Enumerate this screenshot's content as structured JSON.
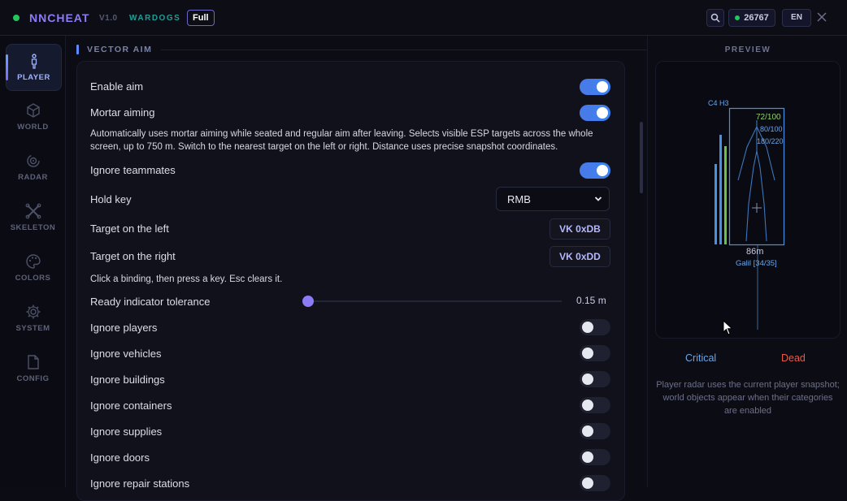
{
  "header": {
    "app_title": "NNCHEAT",
    "version": "V1.0",
    "brand": "WARDOGS",
    "badge": "Full",
    "credits": "26767",
    "language": "EN"
  },
  "sidebar": {
    "items": [
      {
        "label": "PLAYER",
        "icon": "person-icon",
        "active": true
      },
      {
        "label": "WORLD",
        "icon": "cube-icon",
        "active": false
      },
      {
        "label": "RADAR",
        "icon": "radar-icon",
        "active": false
      },
      {
        "label": "SKELETON",
        "icon": "skeleton-icon",
        "active": false
      },
      {
        "label": "COLORS",
        "icon": "palette-icon",
        "active": false
      },
      {
        "label": "SYSTEM",
        "icon": "gear-icon",
        "active": false
      },
      {
        "label": "CONFIG",
        "icon": "file-icon",
        "active": false
      }
    ]
  },
  "main": {
    "section_title": "VECTOR AIM",
    "enable_aim": {
      "label": "Enable aim",
      "on": true
    },
    "mortar_aiming": {
      "label": "Mortar aiming",
      "on": true
    },
    "description": "Automatically uses mortar aiming while seated and regular aim after leaving. Selects visible ESP targets across the whole screen, up to 750 m. Switch to the nearest target on the left or right. Distance uses precise snapshot coordinates.",
    "ignore_teammates": {
      "label": "Ignore teammates",
      "on": true
    },
    "hold_key": {
      "label": "Hold key",
      "value": "RMB"
    },
    "target_left": {
      "label": "Target on the left",
      "key": "VK 0xDB"
    },
    "target_right": {
      "label": "Target on the right",
      "key": "VK 0xDD"
    },
    "binding_hint": "Click a binding, then press a key. Esc clears it.",
    "ready_tolerance": {
      "label": "Ready indicator tolerance",
      "value": "0.15 m",
      "fraction": 0.0
    },
    "ignore_toggles": [
      {
        "label": "Ignore players",
        "on": false
      },
      {
        "label": "Ignore vehicles",
        "on": false
      },
      {
        "label": "Ignore buildings",
        "on": false
      },
      {
        "label": "Ignore containers",
        "on": false
      },
      {
        "label": "Ignore supplies",
        "on": false
      },
      {
        "label": "Ignore doors",
        "on": false
      },
      {
        "label": "Ignore repair stations",
        "on": false
      }
    ]
  },
  "preview": {
    "title": "PREVIEW",
    "tag": "C4 H3",
    "health": "72/100",
    "armor": "80/100",
    "ammo": "180/220",
    "distance": "86m",
    "weapon": "Galil [34/35]",
    "legend_critical": "Critical",
    "legend_dead": "Dead",
    "note": "Player radar uses the current player snapshot; world objects appear when their categories are enabled"
  },
  "colors": {
    "accent": "#8b7cf6",
    "toggle_on": "#3a82f0",
    "green": "#22c55e",
    "critical": "#6aa6e8",
    "dead": "#e85a4a",
    "health_text": "#8fd16a"
  }
}
